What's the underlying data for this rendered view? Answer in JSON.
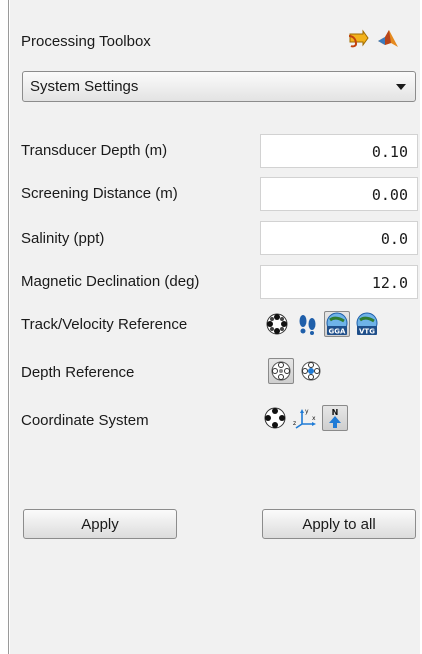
{
  "toolbox": {
    "title": "Processing Toolbox",
    "header_icons": [
      "export-icon",
      "matlab-icon"
    ]
  },
  "settings_select": {
    "value": "System Settings"
  },
  "fields": [
    {
      "label": "Transducer Depth (m)",
      "value": "0.10"
    },
    {
      "label": "Screening Distance (m)",
      "value": "0.00"
    },
    {
      "label": "Salinity (ppt)",
      "value": "0.0"
    },
    {
      "label": "Magnetic Declination (deg)",
      "value": "12.0"
    }
  ],
  "track_reference": {
    "label": "Track/Velocity Reference",
    "options": [
      {
        "icon": "bottom-track-icon",
        "selected": false
      },
      {
        "icon": "footprints-icon",
        "selected": false
      },
      {
        "icon": "gga-icon",
        "text": "GGA",
        "selected": true
      },
      {
        "icon": "vtg-icon",
        "text": "VTG",
        "selected": false
      }
    ]
  },
  "depth_reference": {
    "label": "Depth Reference",
    "options": [
      {
        "icon": "beam-depth-icon",
        "selected": true
      },
      {
        "icon": "vertical-beam-icon",
        "selected": false
      }
    ]
  },
  "coordinate_system": {
    "label": "Coordinate System",
    "options": [
      {
        "icon": "beam-coords-icon",
        "selected": false
      },
      {
        "icon": "xyz-axes-icon",
        "text": "x y z",
        "selected": false
      },
      {
        "icon": "north-arrow-icon",
        "text": "N",
        "selected": true
      }
    ]
  },
  "buttons": {
    "apply": "Apply",
    "apply_all": "Apply to all"
  },
  "colors": {
    "panel": "#f1f1f1",
    "accent_blue": "#1f7bd6",
    "orange": "#e58a1f"
  }
}
